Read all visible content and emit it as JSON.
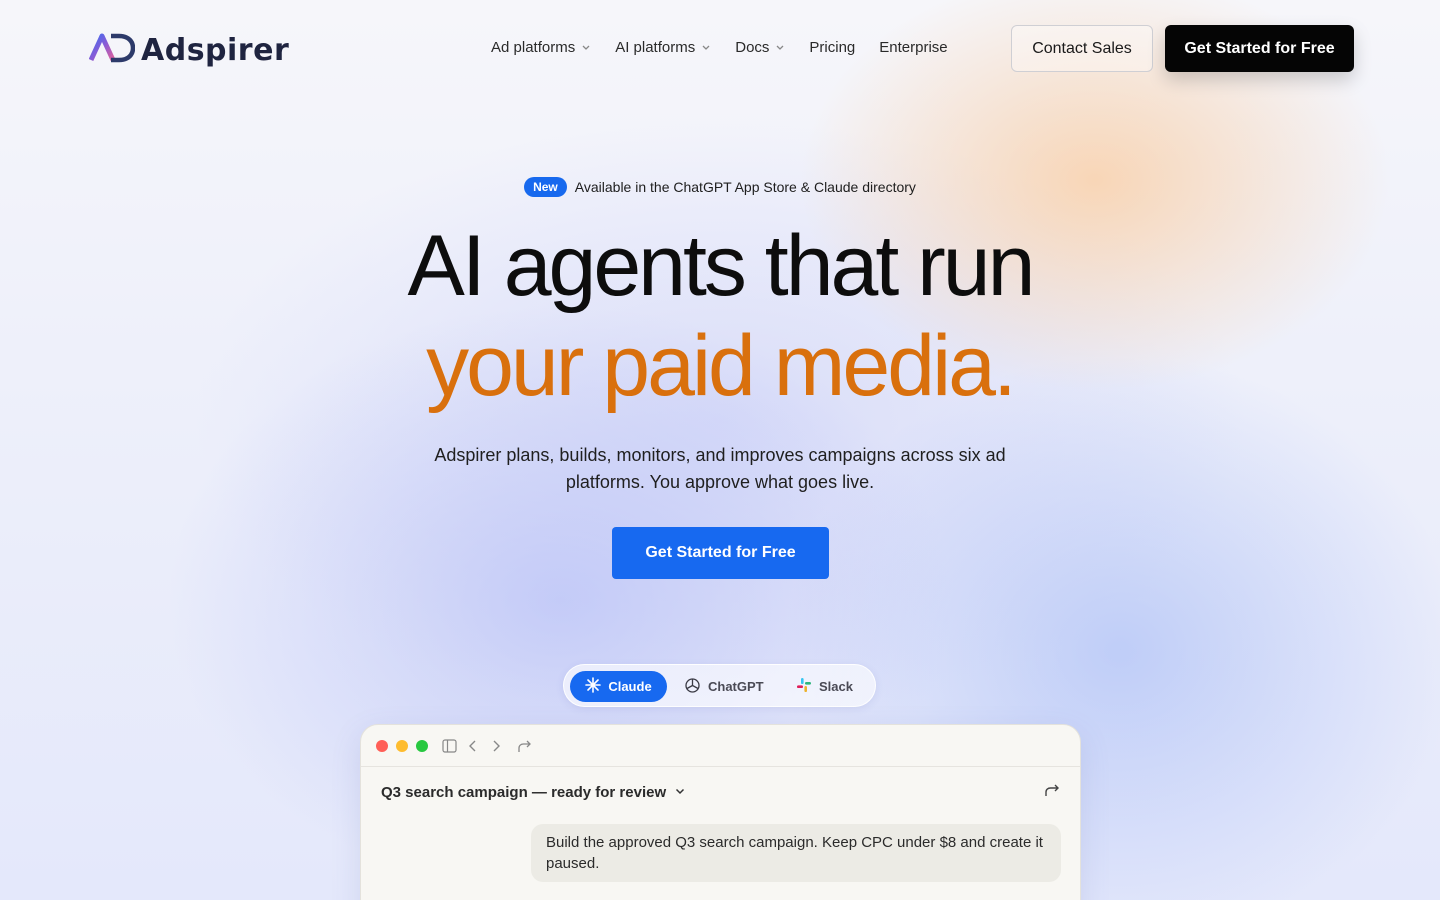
{
  "brand": {
    "name": "Adspirer"
  },
  "nav": {
    "items": [
      {
        "label": "Ad platforms",
        "has_dropdown": true
      },
      {
        "label": "AI platforms",
        "has_dropdown": true
      },
      {
        "label": "Docs",
        "has_dropdown": true
      },
      {
        "label": "Pricing",
        "has_dropdown": false
      },
      {
        "label": "Enterprise",
        "has_dropdown": false
      }
    ],
    "contact_label": "Contact Sales",
    "cta_label": "Get Started for Free"
  },
  "hero": {
    "badge": "New",
    "announcement": "Available in the ChatGPT App Store & Claude directory",
    "headline_line1": "AI agents that run",
    "headline_line2": "your paid media.",
    "subtitle": "Adspirer plans, builds, monitors, and improves campaigns across six ad platforms. You approve what goes live.",
    "cta_label": "Get Started for Free"
  },
  "switcher": {
    "tabs": [
      {
        "label": "Claude",
        "icon": "claude-icon",
        "active": true
      },
      {
        "label": "ChatGPT",
        "icon": "chatgpt-icon",
        "active": false
      },
      {
        "label": "Slack",
        "icon": "slack-icon",
        "active": false
      }
    ]
  },
  "demo": {
    "conversation_title": "Q3 search campaign — ready for review",
    "user_message": "Build the approved Q3 search campaign. Keep CPC under $8 and create it paused."
  },
  "colors": {
    "accent_blue": "#1769f0",
    "headline_orange": "#d9700d",
    "cta_black": "#050505"
  }
}
